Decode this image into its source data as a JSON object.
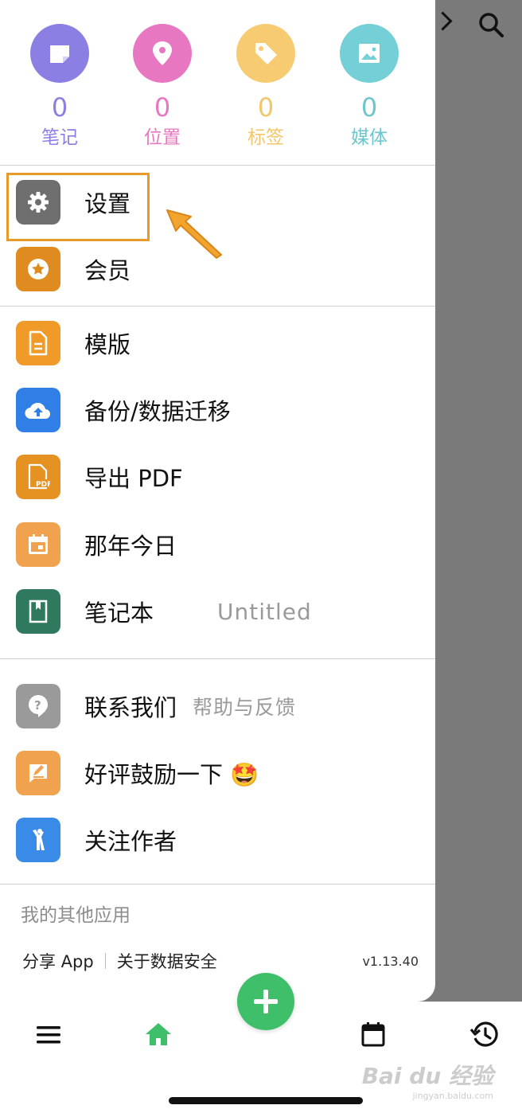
{
  "stats": [
    {
      "count": "0",
      "label": "笔记",
      "icon": "note-icon",
      "color": "#8b7fe3",
      "text_color": "#8b7fe3"
    },
    {
      "count": "0",
      "label": "位置",
      "icon": "location-pin-icon",
      "color": "#e777c0",
      "text_color": "#e777c0"
    },
    {
      "count": "0",
      "label": "标签",
      "icon": "tag-icon",
      "color": "#f7cb72",
      "text_color": "#f2c66a"
    },
    {
      "count": "0",
      "label": "媒体",
      "icon": "image-icon",
      "color": "#74d0d6",
      "text_color": "#6cc6cc"
    }
  ],
  "menu": {
    "settings": {
      "label": "设置",
      "icon": "gear-icon",
      "color": "#6e6e6e"
    },
    "membership": {
      "label": "会员",
      "icon": "star-badge-icon",
      "color": "#e08b20"
    },
    "templates": {
      "label": "模版",
      "icon": "document-icon",
      "color": "#f09a2a"
    },
    "backup": {
      "label": "备份/数据迁移",
      "icon": "cloud-upload-icon",
      "color": "#2f7fe6"
    },
    "export_pdf": {
      "label": "导出 PDF",
      "icon": "pdf-icon",
      "color": "#e59223"
    },
    "on_this_day": {
      "label": "那年今日",
      "icon": "calendar-icon",
      "color": "#f0a24e"
    },
    "notebook": {
      "label": "笔记本",
      "value": "Untitled",
      "icon": "notebook-icon",
      "color": "#2f7a5e"
    },
    "contact": {
      "label": "联系我们",
      "sub": "帮助与反馈",
      "icon": "help-icon",
      "color": "#9a9a9a"
    },
    "review": {
      "label": "好评鼓励一下 🤩",
      "icon": "edit-icon",
      "color": "#f0a24e"
    },
    "follow": {
      "label": "关注作者",
      "icon": "person-icon",
      "color": "#3a8ae8"
    }
  },
  "other_apps_label": "我的其他应用",
  "footer": {
    "share": "分享 App",
    "data_security": "关于数据安全",
    "version": "v1.13.40"
  },
  "watermark": {
    "brand": "Bai du 经验",
    "url": "jingyan.baidu.com"
  },
  "colors": {
    "accent_green": "#3fbf6a",
    "highlight": "#e59a2a"
  }
}
